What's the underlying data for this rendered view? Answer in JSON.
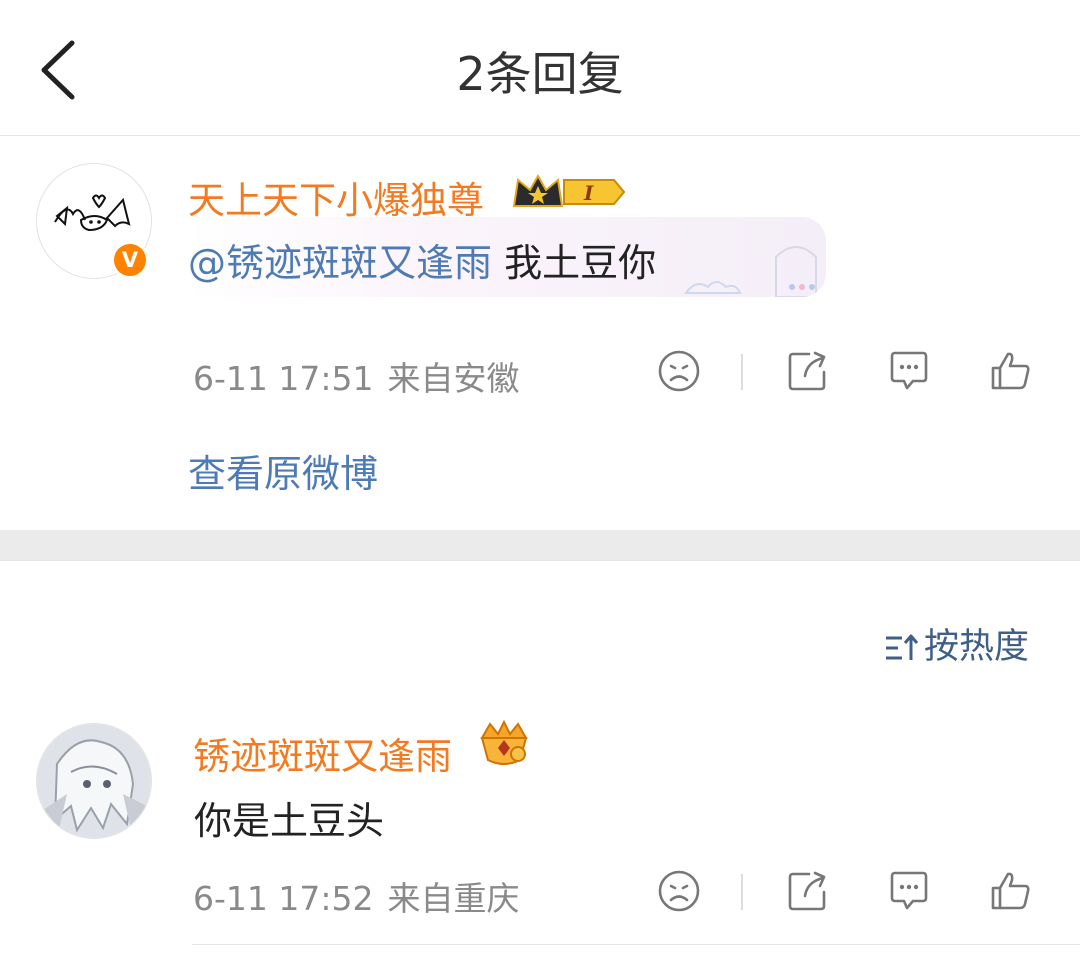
{
  "header": {
    "title": "2条回复"
  },
  "original_comment": {
    "username": "天上天下小爆独尊",
    "badge_text": "I",
    "verified_badge": "V",
    "mention": "@锈迹斑斑又逢雨",
    "text": " 我土豆你",
    "date": "6-11 17:51",
    "location": "来自安徽",
    "actions": [
      "dislike-face-icon",
      "share-icon",
      "comment-icon",
      "like-thumb-icon"
    ]
  },
  "view_original_label": "查看原微博",
  "sort_label": "按热度",
  "replies": [
    {
      "username": "锈迹斑斑又逢雨",
      "text": "你是土豆头",
      "date": "6-11 17:52",
      "location": "来自重庆"
    }
  ],
  "colors": {
    "username": "#f37a1f",
    "link": "#4f7bb5",
    "meta": "#8a8a8a",
    "sort": "#3f5f89"
  }
}
